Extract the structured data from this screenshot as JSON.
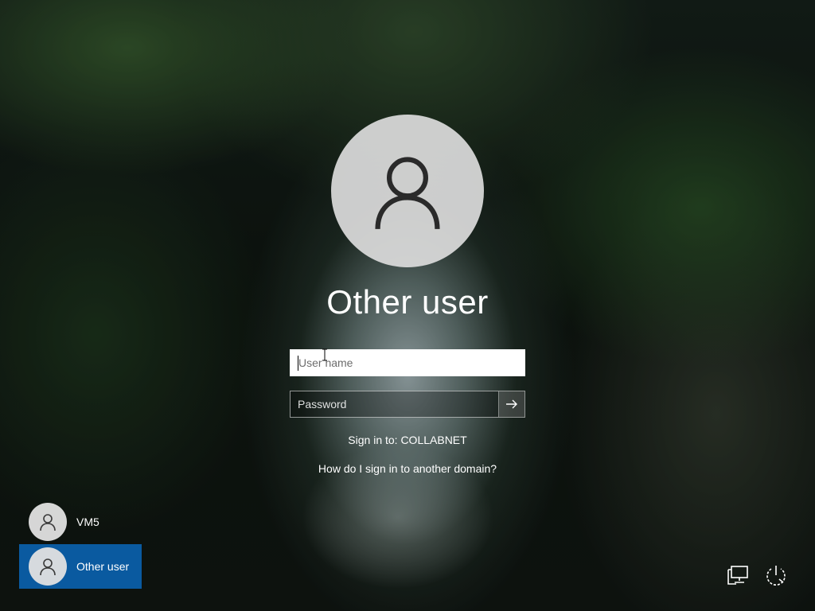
{
  "login": {
    "current_user_title": "Other user",
    "username_placeholder": "User name",
    "password_placeholder": "Password",
    "sign_in_to": "Sign in to: COLLABNET",
    "domain_help_link": "How do I sign in to another domain?"
  },
  "user_list": {
    "items": [
      {
        "label": "VM5",
        "selected": false
      },
      {
        "label": "Other user",
        "selected": true
      }
    ]
  },
  "icons": {
    "avatar": "user-avatar-icon",
    "submit": "arrow-right-icon",
    "network": "network-icon",
    "power": "power-icon"
  },
  "colors": {
    "selected_user_background": "#0a5aa0",
    "avatar_background": "#dcdcdc"
  }
}
